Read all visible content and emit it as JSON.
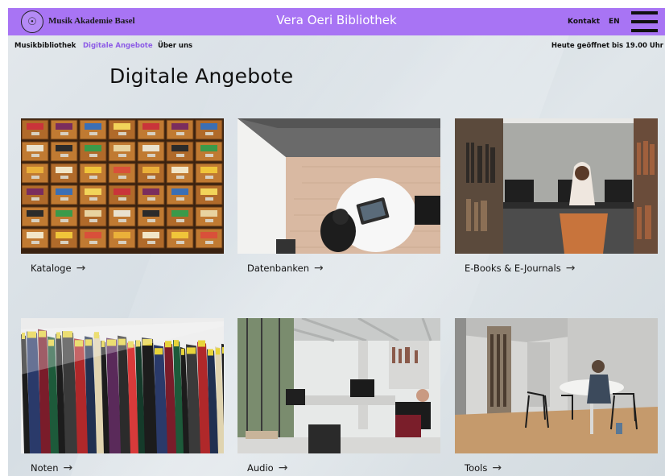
{
  "header": {
    "logo_glyph": "☉",
    "brand": "Musik Akademie Basel",
    "site_title": "Vera Oeri Bibliothek",
    "kontakt": "Kontakt",
    "lang": "EN",
    "accent": "#a874f4"
  },
  "subnav": {
    "items": [
      "Musikbibliothek",
      "Digitale Angebote",
      "Über uns"
    ],
    "active": "Digitale Angebote",
    "active_color": "#8e5de6",
    "hours": "Heute geöffnet bis 19.00 Uhr"
  },
  "page": {
    "title": "Digitale Angebote"
  },
  "cards": [
    {
      "label": "Kataloge",
      "arrow": "→"
    },
    {
      "label": "Datenbanken",
      "arrow": "→"
    },
    {
      "label": "E-Books & E-Journals",
      "arrow": "→"
    },
    {
      "label": "Noten",
      "arrow": "→"
    },
    {
      "label": "Audio",
      "arrow": "→"
    },
    {
      "label": "Tools",
      "arrow": "→"
    }
  ]
}
